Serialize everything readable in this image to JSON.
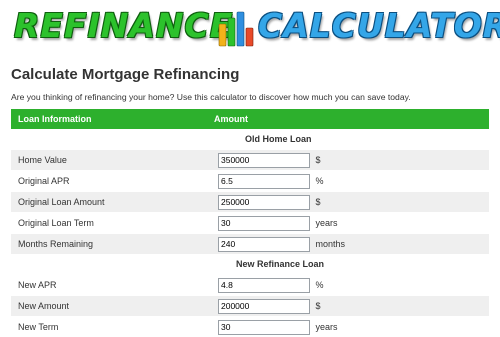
{
  "banner": {
    "logo_left": "REFINANCE",
    "logo_right": "CALCULATOR",
    "chart_colors": [
      "#f2b21a",
      "#2cc22c",
      "#2f8fe0",
      "#e84a2a"
    ]
  },
  "heading": {
    "title": "Calculate Mortgage Refinancing",
    "intro": "Are you thinking of refinancing your home? Use this calculator to discover how much you can save today."
  },
  "table": {
    "headers": [
      "Loan Information",
      "Amount"
    ],
    "sections": {
      "old": "Old Home Loan",
      "new": "New Refinance Loan"
    },
    "old_rows": [
      {
        "label": "Home Value",
        "value": "350000",
        "unit": "$"
      },
      {
        "label": "Original APR",
        "value": "6.5",
        "unit": "%"
      },
      {
        "label": "Original Loan Amount",
        "value": "250000",
        "unit": "$"
      },
      {
        "label": "Original Loan Term",
        "value": "30",
        "unit": "years"
      },
      {
        "label": "Months Remaining",
        "value": "240",
        "unit": "months"
      }
    ],
    "new_rows": [
      {
        "label": "New APR",
        "value": "4.8",
        "unit": "%"
      },
      {
        "label": "New Amount",
        "value": "200000",
        "unit": "$"
      },
      {
        "label": "New Term",
        "value": "30",
        "unit": "years"
      }
    ]
  },
  "colors": {
    "header_green": "#2db02d",
    "row_gray": "#efefef",
    "logo_green": "#2cc22c",
    "logo_blue": "#34a6e8"
  }
}
